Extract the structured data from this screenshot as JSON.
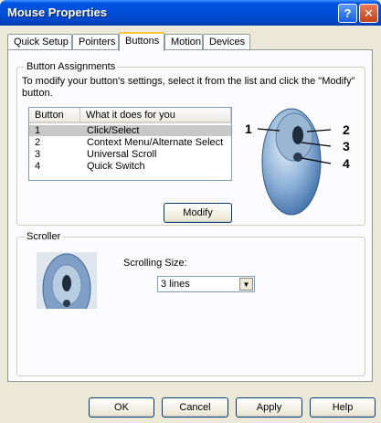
{
  "window": {
    "title": "Mouse Properties",
    "help_glyph": "?",
    "close_glyph": "✕"
  },
  "tabs": [
    {
      "label": "Quick Setup"
    },
    {
      "label": "Pointers"
    },
    {
      "label": "Buttons",
      "active": true
    },
    {
      "label": "Motion"
    },
    {
      "label": "Devices"
    }
  ],
  "assignments": {
    "group_label": "Button Assignments",
    "description": "To modify your button's settings, select it from the list and click the \"Modify\" button.",
    "columns": [
      "Button",
      "What it does for you"
    ],
    "rows": [
      {
        "button": "1",
        "action": "Click/Select",
        "selected": true
      },
      {
        "button": "2",
        "action": "Context Menu/Alternate Select"
      },
      {
        "button": "3",
        "action": "Universal Scroll"
      },
      {
        "button": "4",
        "action": "Quick Switch"
      }
    ],
    "modify_label": "Modify",
    "callouts": [
      "1",
      "2",
      "3",
      "4"
    ]
  },
  "scroller": {
    "group_label": "Scroller",
    "size_label": "Scrolling Size:",
    "size_value": "3 lines"
  },
  "footer": {
    "ok": "OK",
    "cancel": "Cancel",
    "apply": "Apply",
    "help": "Help"
  },
  "colors": {
    "titlebar": "#0054e3",
    "dialog_bg": "#ece9d8",
    "panel_bg": "#fcfcfe",
    "selected_row": "#c8c8c8",
    "active_tab": "#ffc83c"
  }
}
